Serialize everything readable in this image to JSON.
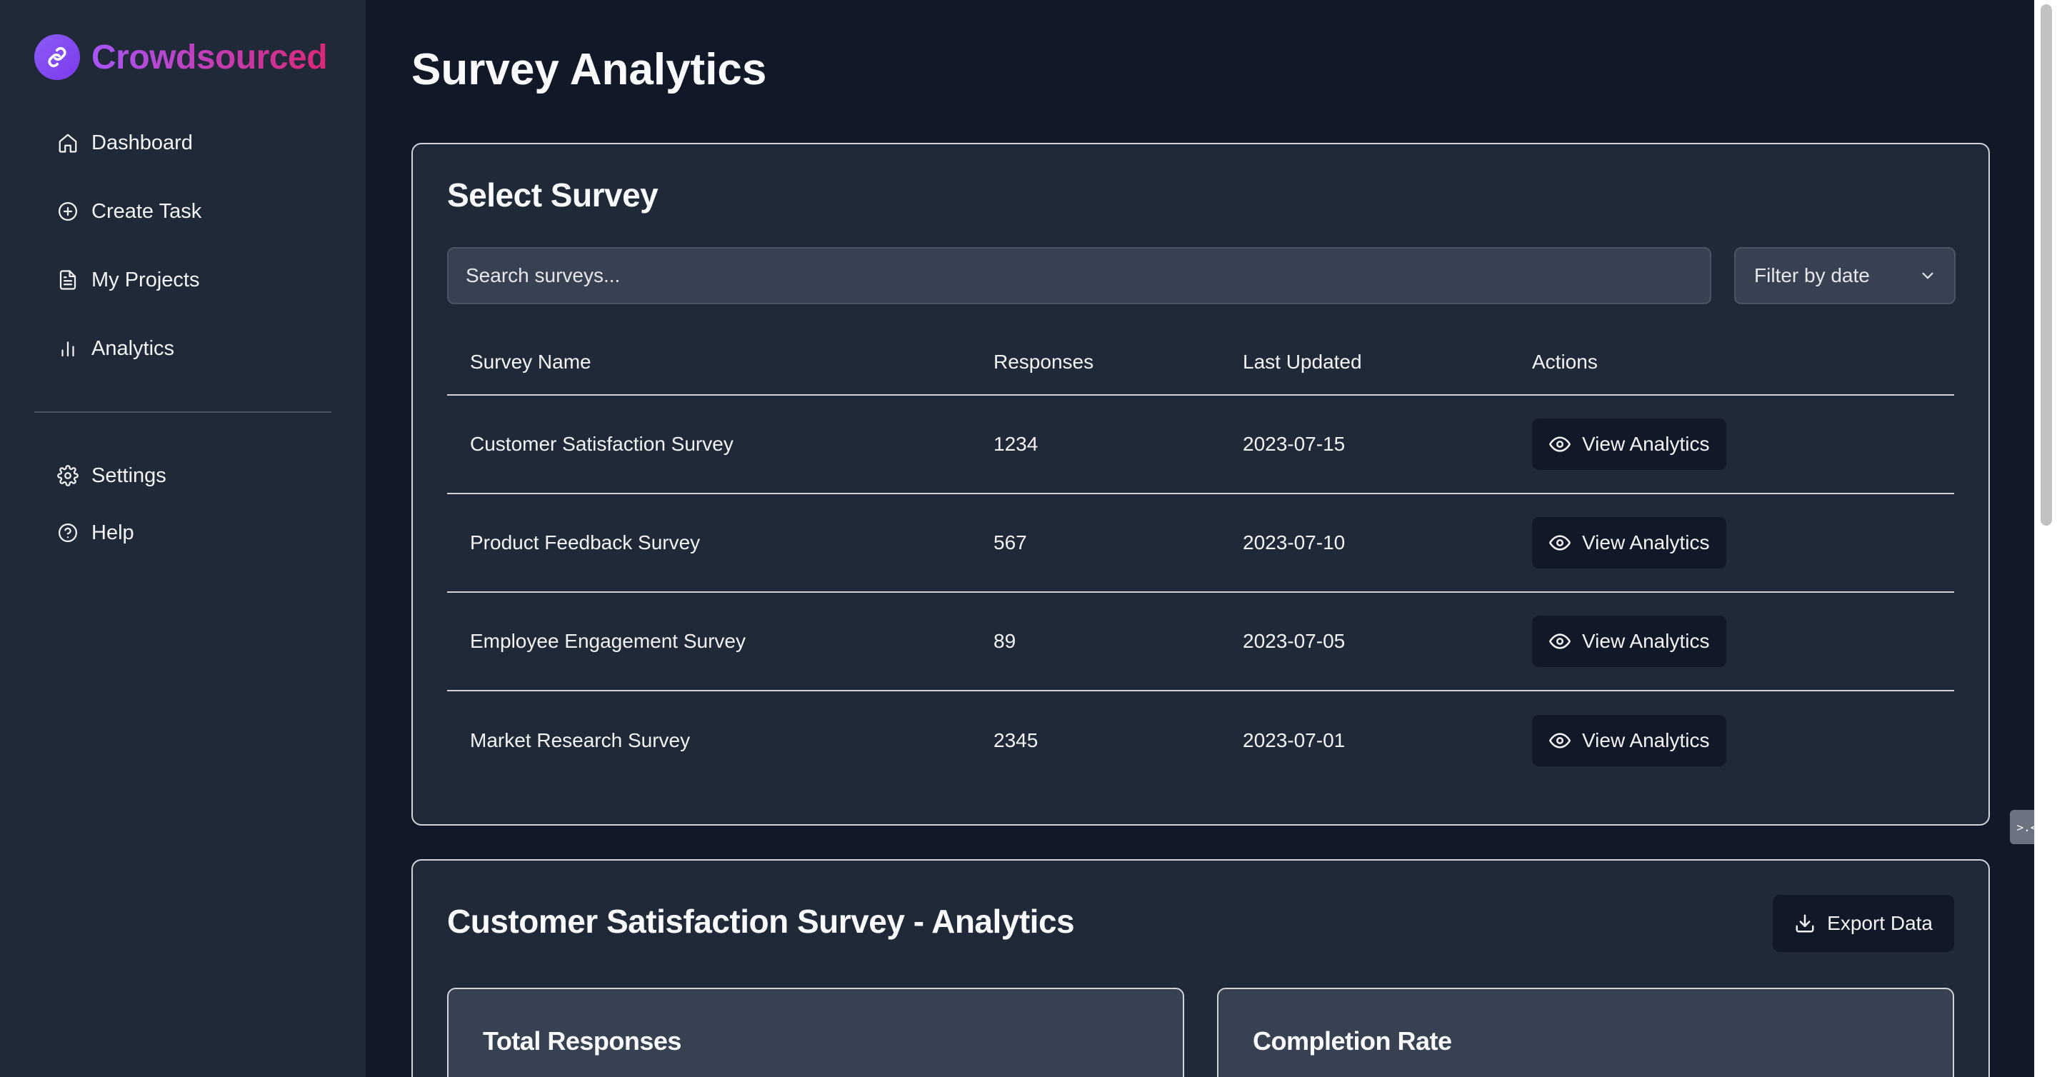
{
  "app": {
    "brand": "Crowdsourced",
    "colors": {
      "brand_from": "#a855f7",
      "brand_to": "#db2777",
      "bg": "#111827",
      "panel": "#1f2937"
    }
  },
  "sidebar": {
    "items": [
      {
        "label": "Dashboard",
        "icon": "home-icon"
      },
      {
        "label": "Create Task",
        "icon": "plus-circle-icon"
      },
      {
        "label": "My Projects",
        "icon": "document-icon"
      },
      {
        "label": "Analytics",
        "icon": "bar-chart-icon"
      }
    ],
    "secondary": [
      {
        "label": "Settings",
        "icon": "gear-icon"
      },
      {
        "label": "Help",
        "icon": "help-circle-icon"
      }
    ]
  },
  "page": {
    "title": "Survey Analytics"
  },
  "select_survey": {
    "title": "Select Survey",
    "search": {
      "placeholder": "Search surveys...",
      "value": ""
    },
    "filter": {
      "selected": "Filter by date"
    },
    "columns": [
      "Survey Name",
      "Responses",
      "Last Updated",
      "Actions"
    ],
    "rows": [
      {
        "name": "Customer Satisfaction Survey",
        "responses": "1234",
        "updated": "2023-07-15",
        "action": "View Analytics"
      },
      {
        "name": "Product Feedback Survey",
        "responses": "567",
        "updated": "2023-07-10",
        "action": "View Analytics"
      },
      {
        "name": "Employee Engagement Survey",
        "responses": "89",
        "updated": "2023-07-05",
        "action": "View Analytics"
      },
      {
        "name": "Market Research Survey",
        "responses": "2345",
        "updated": "2023-07-01",
        "action": "View Analytics"
      }
    ]
  },
  "analytics": {
    "title": "Customer Satisfaction Survey - Analytics",
    "export_label": "Export Data",
    "stats": [
      {
        "title": "Total Responses"
      },
      {
        "title": "Completion Rate"
      }
    ]
  },
  "floating_widget": {
    "label": ">.<"
  }
}
